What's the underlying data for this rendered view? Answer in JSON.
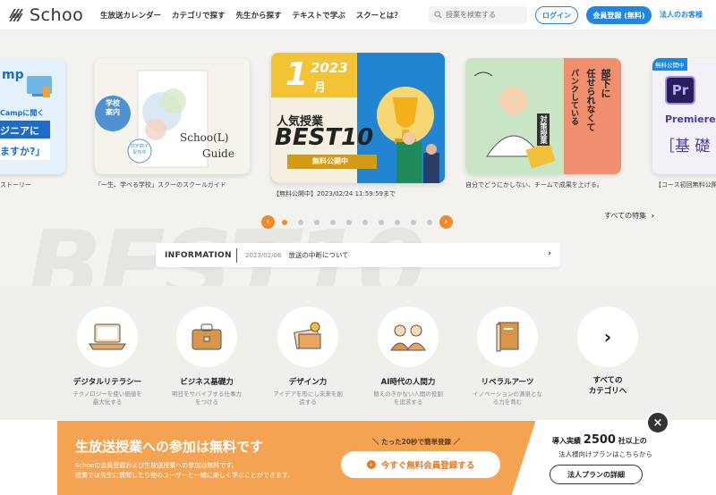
{
  "header": {
    "logo": "Schoo",
    "nav": [
      "生放送カレンダー",
      "カテゴリで探す",
      "先生から探す",
      "テキストで学ぶ",
      "スクーとは？"
    ],
    "search_placeholder": "授業を検索する",
    "login": "ログイン",
    "register": "会員登録 (無料)",
    "corporate": "法人のお客様"
  },
  "hero": {
    "bg_text": "BEST10",
    "cards": {
      "c1": {
        "title_small": "mp",
        "line1": "Campに聞く",
        "line2": "ジニアに",
        "line3": "ますか?」",
        "caption": "ストーリー"
      },
      "c2": {
        "badge": "学校\n案内",
        "pdf": "PDF冊子\n配布中",
        "title1": "Schoo(L)",
        "title2": "Guide",
        "caption": "「一生、学べる学校」スクーのスクールガイド"
      },
      "c3": {
        "month_num": "1",
        "month": "月",
        "year": "2023",
        "line1": "人気授業",
        "best": "BEST",
        "ten": "10",
        "ribbon": "無料公開中",
        "caption": "【無料公開中】2023/02/24 11:59:59まで"
      },
      "c4": {
        "v1": "部下に",
        "v2": "任せられなくて",
        "v3": "パンクしている",
        "tag": "対策授業",
        "caption": "自分でどうにかしない、チームで成果を上げる。"
      },
      "c5": {
        "badge": "無料公開中",
        "pr": "Pr",
        "name": "Premiere",
        "kanji": "［基 礎",
        "caption": "【コース初回無料公開"
      }
    },
    "carousel": {
      "prev": "‹",
      "next": "›",
      "dots": 10,
      "active_index": 0
    },
    "all_features": "すべての特集"
  },
  "info": {
    "label": "INFORMATION",
    "date": "2023/02/06",
    "text": "放送の中断について"
  },
  "categories": [
    {
      "title": "デジタルリテラシー",
      "desc": "テクノロジーを使い価値を\n最大化する",
      "icon": "laptop-icon"
    },
    {
      "title": "ビジネス基礎力",
      "desc": "明日をサバイブする仕事力\nをつける",
      "icon": "briefcase-icon"
    },
    {
      "title": "デザイン力",
      "desc": "アイデアを形にし未来を創\n造する",
      "icon": "design-icon"
    },
    {
      "title": "AI時代の人間力",
      "desc": "替えのきかない人間の役割\nを追求する",
      "icon": "people-icon"
    },
    {
      "title": "リベラルアーツ",
      "desc": "イノベーションの源泉とな\nる力を育む",
      "icon": "book-icon"
    },
    {
      "title": "すべての\nカテゴリへ",
      "desc": "",
      "icon": "chevron-right-icon"
    }
  ],
  "banner": {
    "title": "生放送授業への参加は無料です",
    "text1": "Schooの会員登録および生放送授業への参加は無料です。",
    "text2": "授業では先生に質問したり他のユーザーと一緒に楽しく学ぶことができます。",
    "note": "＼ たった20秒で簡単登録 ／",
    "cta": "今すぐ無料会員登録する",
    "right_pre": "導入実績",
    "right_num": "2500",
    "right_post": "社以上の",
    "right_sub": "法人様向けプランはこちらから",
    "right_btn": "法人プランの詳細",
    "close": "×"
  },
  "colors": {
    "accent": "#f08a2b",
    "blue": "#1f86e2",
    "banner": "#f4a353"
  }
}
